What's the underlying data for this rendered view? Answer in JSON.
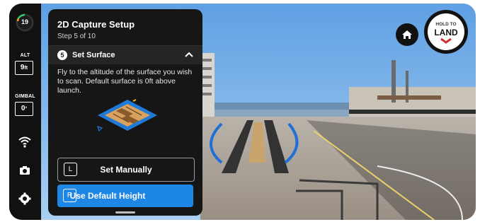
{
  "left_bar": {
    "battery_percent": "19",
    "altitude_label": "ALT",
    "altitude_value": "9",
    "altitude_unit": "ft",
    "gimbal_label": "GIMBAL",
    "gimbal_value": "0",
    "gimbal_unit": "°",
    "icons": [
      "wifi-icon",
      "camera-icon",
      "settings-gear-icon"
    ]
  },
  "panel": {
    "title": "2D Capture Setup",
    "step": "Step 5 of 10",
    "section_number": "5",
    "section_title": "Set Surface",
    "description": "Fly to the altitude of the surface you wish to scan. Default surface is 0ft above launch.",
    "buttons": [
      {
        "key": "L",
        "label": "Set Manually"
      },
      {
        "key": "R",
        "label": "Use Default Height"
      }
    ]
  },
  "right_controls": {
    "land_hold_text": "HOLD TO",
    "land_text": "LAND"
  },
  "colors": {
    "accent_blue": "#1e87e5",
    "panel_bg": "#161616",
    "land_chevron_red": "#d32f2f"
  }
}
